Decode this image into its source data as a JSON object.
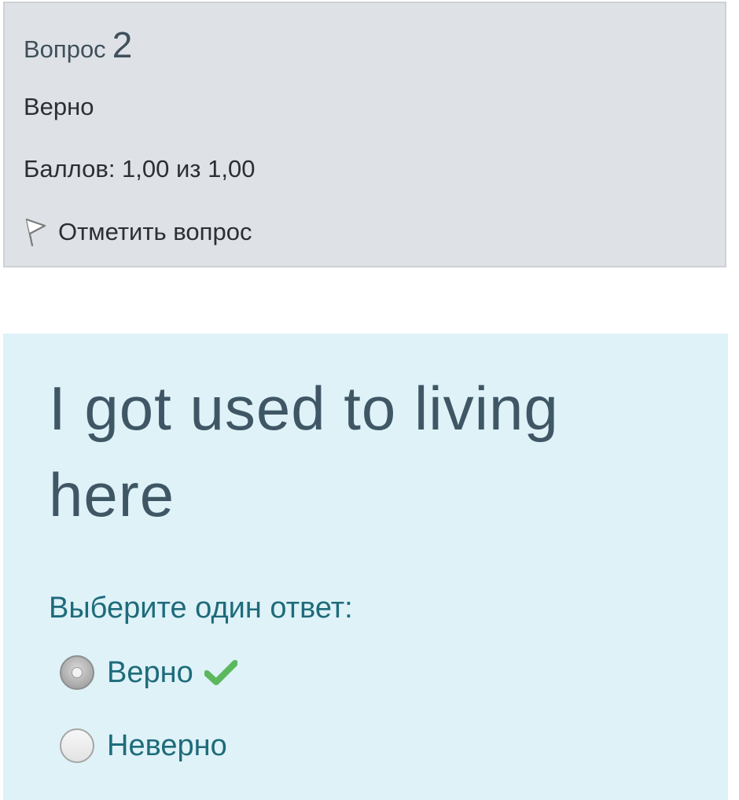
{
  "info": {
    "question_label": "Вопрос",
    "question_number": "2",
    "state": "Верно",
    "grade": "Баллов: 1,00 из 1,00",
    "flag_label": "Отметить вопрос"
  },
  "question": {
    "text": "I got used to living here",
    "prompt": "Выберите один ответ:",
    "options": [
      {
        "label": "Верно",
        "selected": true,
        "correct": true
      },
      {
        "label": "Неверно",
        "selected": false
      }
    ]
  },
  "icons": {
    "flag": "flag-outline-icon",
    "check": "check-icon"
  },
  "colors": {
    "info_background": "#dee2e6",
    "question_background": "#def2f8",
    "question_text": "#3f5765",
    "answer_text": "#1e6b7a",
    "correct_check": "#5cb85c"
  }
}
